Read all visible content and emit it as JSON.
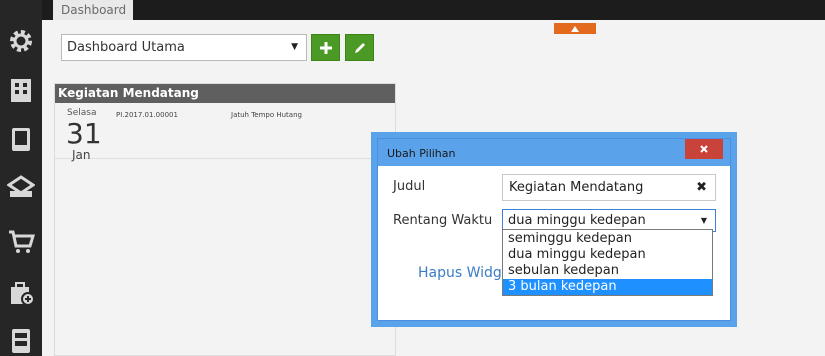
{
  "tabs": [
    {
      "label": "Dashboard"
    }
  ],
  "sidebar": {
    "icons": [
      "settings-gear-icon",
      "building-icon",
      "book-icon",
      "stack-icon",
      "cart-icon",
      "bag-add-icon",
      "archive-icon"
    ]
  },
  "toolbar": {
    "dashboard_value": "Dashboard Utama",
    "add_icon": "plus-icon",
    "edit_icon": "pencil-icon"
  },
  "widget": {
    "title": "Kegiatan Mendatang",
    "events": [
      {
        "day_name": "Selasa",
        "day": "31",
        "month": "Jan",
        "reference": "PI.2017.01.00001",
        "description": "Jatuh Tempo Hutang"
      }
    ]
  },
  "modal": {
    "title": "Ubah Pilihan",
    "close_icon": "close-icon",
    "judul_label": "Judul",
    "judul_value": "Kegiatan Mendatang",
    "clear_symbol": "✖",
    "rentang_label": "Rentang Waktu",
    "rentang_value": "dua minggu kedepan",
    "hapus_label": "Hapus Widget",
    "options": [
      {
        "label": "seminggu kedepan",
        "selected": false
      },
      {
        "label": "dua minggu kedepan",
        "selected": false
      },
      {
        "label": "sebulan kedepan",
        "selected": false
      },
      {
        "label": "3 bulan kedepan",
        "selected": true
      }
    ]
  },
  "colors": {
    "accent_green": "#4c9a26",
    "modal_blue": "#5aa2ea",
    "close_red": "#c9433b",
    "selection_blue": "#1e90ff",
    "collapse_orange": "#e3691f"
  }
}
